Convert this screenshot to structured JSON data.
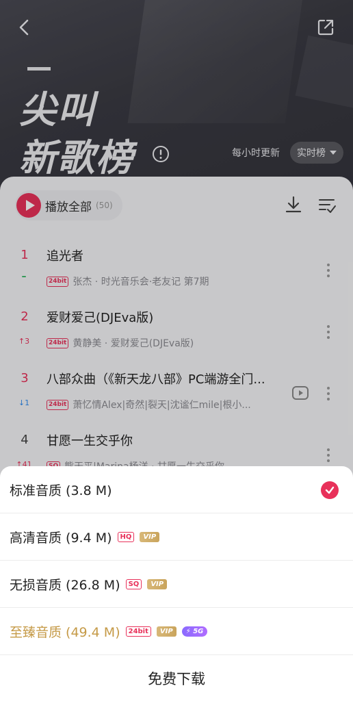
{
  "header": {
    "title_line1": "尖叫",
    "title_line2": "新歌榜",
    "update_text": "每小时更新",
    "rank_type": "实时榜"
  },
  "toolbar": {
    "play_all_label": "播放全部",
    "play_all_count": "(50)"
  },
  "songs": [
    {
      "rank": "1",
      "trend": "–",
      "trend_dir": "flat",
      "title": "追光者",
      "quality_badge": "24bit",
      "subtitle": "张杰 · 时光音乐会·老友记 第7期"
    },
    {
      "rank": "2",
      "trend": "↑3",
      "trend_dir": "up",
      "title": "爱财爱己(DJEva版)",
      "quality_badge": "24bit",
      "subtitle": "黄静美 · 爱财爱己(DJEva版)"
    },
    {
      "rank": "3",
      "trend": "↓1",
      "trend_dir": "down",
      "title": "八部众曲（《新天龙八部》PC端游全门...",
      "quality_badge": "24bit",
      "subtitle": "萧忆情Alex|奇然|裂天|沈谧仁mile|根小..."
    },
    {
      "rank": "4",
      "trend": "↑41",
      "trend_dir": "up",
      "title": "甘愿一生交乎你",
      "quality_badge": "SQ",
      "subtitle": "熊天平|Marina杨洋 · 甘愿一生交乎你"
    }
  ],
  "quality_sheet": {
    "options": [
      {
        "label": "标准音质 (3.8 M)",
        "selected": true
      },
      {
        "label": "高清音质 (9.4 M)",
        "tag": "HQ",
        "vip": "VIP"
      },
      {
        "label": "无损音质 (26.8 M)",
        "tag": "SQ",
        "vip": "VIP"
      },
      {
        "label": "至臻音质 (49.4 M)",
        "tag": "24bit",
        "vip": "VIP",
        "extra": "⚡ 5G"
      }
    ],
    "download_button": "免费下载"
  },
  "colors": {
    "accent": "#e8315a",
    "gold": "#c59a47",
    "header_bg": "#3a3a42"
  }
}
